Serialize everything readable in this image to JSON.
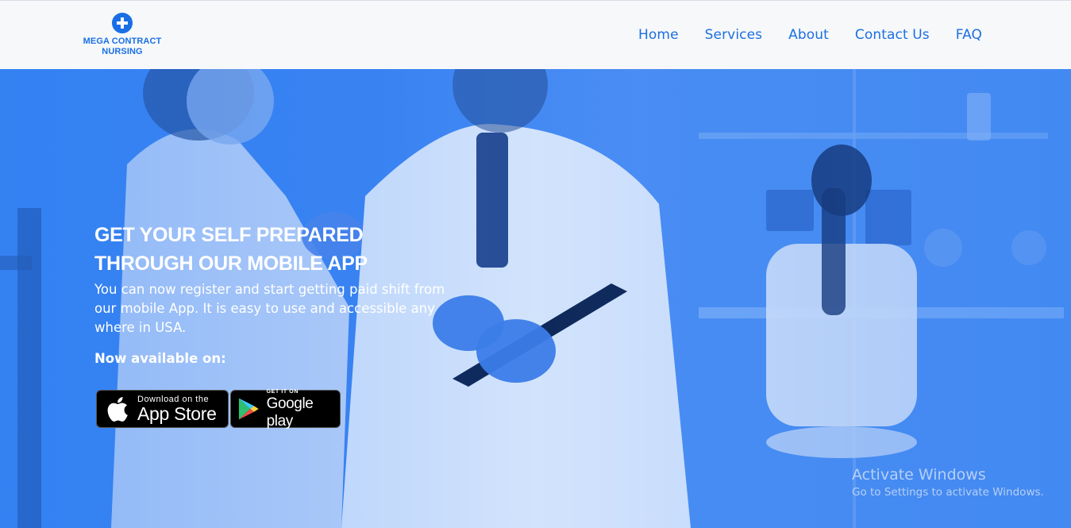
{
  "header": {
    "logo_text": "MEGA CONTRACT NURSING",
    "brand_color": "#1a6fe6",
    "nav": [
      "Home",
      "Services",
      "About",
      "Contact Us",
      "FAQ"
    ]
  },
  "hero": {
    "headline": [
      "GET YOUR SELF PREPARED",
      "THROUGH OUR MOBILE APP"
    ],
    "description": "You can now register and start getting paid shift from our mobile App. It is easy to use and accessible any where in USA.",
    "available_label": "Now available on:",
    "overlay_color": "#2f7cf0",
    "stores": {
      "appstore": {
        "small": "Download on the",
        "big": "App Store",
        "icon": "apple-icon"
      },
      "googleplay": {
        "small": "GET IT ON",
        "big": "Google play",
        "icon": "google-play-icon"
      }
    }
  },
  "watermark": {
    "title": "Activate Windows",
    "subtitle": "Go to Settings to activate Windows."
  }
}
